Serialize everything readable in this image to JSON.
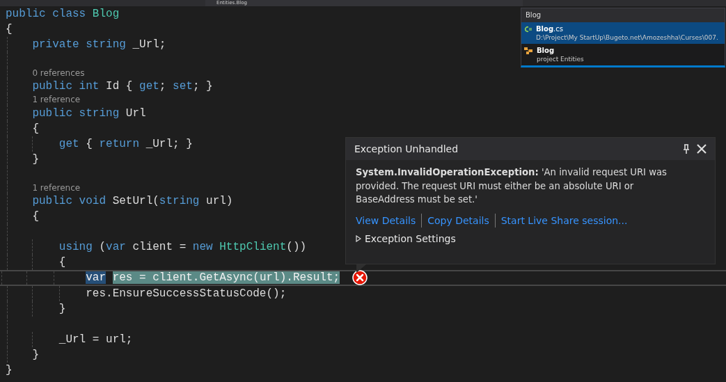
{
  "navigation_bar": {
    "member_dropdown": "Entities.Blog"
  },
  "editor": {
    "lines": [
      {
        "kind": "code",
        "tokens": [
          {
            "kind": "keyword",
            "text": "public class "
          },
          {
            "kind": "type",
            "text": "Blog"
          }
        ]
      },
      {
        "kind": "code",
        "tokens": [
          {
            "kind": "plain",
            "text": "{"
          }
        ]
      },
      {
        "kind": "code",
        "tokens": [
          {
            "kind": "keyword",
            "text": "    private string "
          },
          {
            "kind": "plain",
            "text": "_Url;"
          }
        ]
      },
      {
        "kind": "blank"
      },
      {
        "kind": "codelens",
        "text": "0 references"
      },
      {
        "kind": "code",
        "tokens": [
          {
            "kind": "keyword",
            "text": "    public int "
          },
          {
            "kind": "plain",
            "text": "Id { "
          },
          {
            "kind": "keyword",
            "text": "get"
          },
          {
            "kind": "plain",
            "text": "; "
          },
          {
            "kind": "keyword",
            "text": "set"
          },
          {
            "kind": "plain",
            "text": "; }"
          }
        ]
      },
      {
        "kind": "codelens",
        "text": "1 reference"
      },
      {
        "kind": "code",
        "tokens": [
          {
            "kind": "keyword",
            "text": "    public string "
          },
          {
            "kind": "plain",
            "text": "Url"
          }
        ]
      },
      {
        "kind": "code",
        "tokens": [
          {
            "kind": "plain",
            "text": "    {"
          }
        ]
      },
      {
        "kind": "code",
        "tokens": [
          {
            "kind": "keyword",
            "text": "        get "
          },
          {
            "kind": "plain",
            "text": "{ "
          },
          {
            "kind": "keyword",
            "text": "return "
          },
          {
            "kind": "plain",
            "text": "_Url; }"
          }
        ]
      },
      {
        "kind": "code",
        "tokens": [
          {
            "kind": "plain",
            "text": "    }"
          }
        ]
      },
      {
        "kind": "blank"
      },
      {
        "kind": "codelens",
        "text": "1 reference"
      },
      {
        "kind": "code",
        "tokens": [
          {
            "kind": "keyword",
            "text": "    public void "
          },
          {
            "kind": "plain",
            "text": "SetUrl("
          },
          {
            "kind": "keyword",
            "text": "string "
          },
          {
            "kind": "plain",
            "text": "url)"
          }
        ]
      },
      {
        "kind": "code",
        "tokens": [
          {
            "kind": "plain",
            "text": "    {"
          }
        ]
      },
      {
        "kind": "blank"
      },
      {
        "kind": "code",
        "tokens": [
          {
            "kind": "keyword",
            "text": "        using "
          },
          {
            "kind": "plain",
            "text": "("
          },
          {
            "kind": "keyword",
            "text": "var "
          },
          {
            "kind": "plain",
            "text": "client = "
          },
          {
            "kind": "keyword",
            "text": "new "
          },
          {
            "kind": "type",
            "text": "HttpClient"
          },
          {
            "kind": "plain",
            "text": "())"
          }
        ]
      },
      {
        "kind": "code",
        "tokens": [
          {
            "kind": "plain",
            "text": "        {"
          }
        ]
      },
      {
        "kind": "code",
        "current": true,
        "error": true,
        "tokens": [
          {
            "kind": "keyword",
            "text": "            var",
            "selected": true,
            "statement": true
          },
          {
            "kind": "plain",
            "text": " res = client.GetAsync(url).Result;",
            "selected": false,
            "statement": true
          }
        ]
      },
      {
        "kind": "code",
        "tokens": [
          {
            "kind": "plain",
            "text": "            res.EnsureSuccessStatusCode();"
          }
        ]
      },
      {
        "kind": "code",
        "tokens": [
          {
            "kind": "plain",
            "text": "        }"
          }
        ]
      },
      {
        "kind": "blank"
      },
      {
        "kind": "code",
        "tokens": [
          {
            "kind": "plain",
            "text": "        _Url = url;"
          }
        ]
      },
      {
        "kind": "code",
        "tokens": [
          {
            "kind": "plain",
            "text": "    }"
          }
        ]
      },
      {
        "kind": "code",
        "tokens": [
          {
            "kind": "plain",
            "text": "}"
          }
        ]
      }
    ]
  },
  "search_popup": {
    "query": "Blog",
    "results": [
      {
        "kind": "file",
        "match": "Blog",
        "suffix": ".cs",
        "detail": "D:\\Project\\My StartUp\\Bugeto.net\\Amozeshha\\Curses\\007.",
        "selected": true
      },
      {
        "kind": "class",
        "match": "Blog",
        "detail": "project Entities",
        "selected": false
      }
    ]
  },
  "exception_popup": {
    "title": "Exception Unhandled",
    "message": "**System.InvalidOperationException:** 'An invalid request URI was provided. The request URI must either be an absolute URI or BaseAddress must be set.'",
    "links": [
      "View Details",
      "Copy Details",
      "Start Live Share session..."
    ],
    "settings": {
      "label": "Exception Settings",
      "expanded": false
    }
  }
}
